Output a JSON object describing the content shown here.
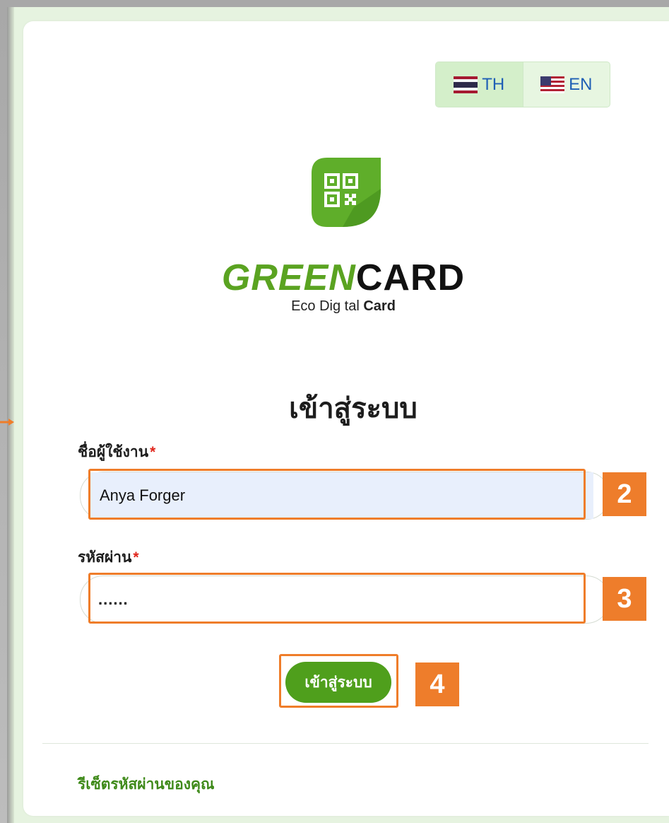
{
  "language": {
    "th_label": "TH",
    "en_label": "EN",
    "active": "TH"
  },
  "logo": {
    "brand_green": "GREEN",
    "brand_dark": "CARD",
    "tagline_prefix": "Eco Dig tal",
    "tagline_bold": "Card"
  },
  "page_title": "เข้าสู่ระบบ",
  "form": {
    "username_label": "ชื่อผู้ใช้งาน",
    "username_value": "Anya Forger",
    "password_label": "รหัสผ่าน",
    "password_value": "......",
    "required_mark": "*",
    "submit_label": "เข้าสู่ระบบ"
  },
  "steps": {
    "username": "2",
    "password": "3",
    "submit": "4"
  },
  "footer": {
    "reset_link": "รีเซ็ตรหัสผ่านของคุณ"
  },
  "colors": {
    "accent_green": "#4f9f1c",
    "highlight_orange": "#ef7d2a",
    "required_red": "#e0251b"
  }
}
